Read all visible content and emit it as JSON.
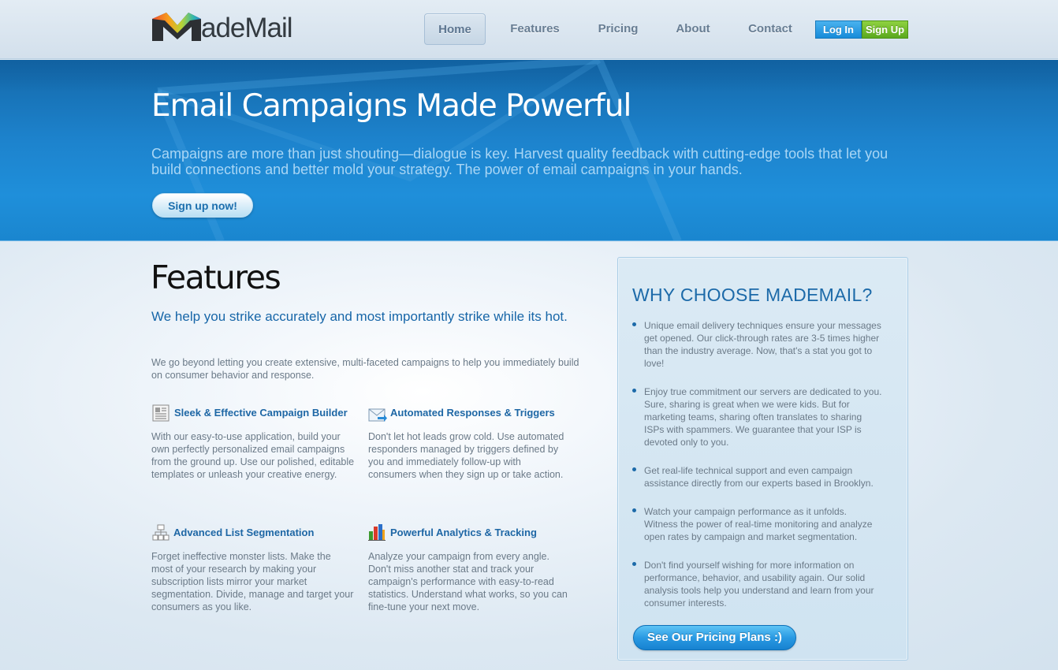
{
  "header": {
    "logo_text": "adeMail",
    "nav": [
      {
        "label": "Home"
      },
      {
        "label": "Features"
      },
      {
        "label": "Pricing"
      },
      {
        "label": "About"
      },
      {
        "label": "Contact"
      }
    ],
    "login_label": "Log In",
    "signup_label": "Sign Up"
  },
  "hero": {
    "title": "Email Campaigns Made Powerful",
    "text": "Campaigns are more than just shouting—dialogue is key. Harvest quality feedback with cutting-edge tools that let you build connections and better mold your strategy. The power of email campaigns in your hands.",
    "cta_label": "Sign up now!"
  },
  "features": {
    "title": "Features",
    "subtitle": "We help you strike accurately and most importantly strike while its hot.",
    "intro": "We go beyond letting you create extensive, multi-faceted campaigns to help you immediately build on consumer behavior and response.",
    "items": [
      {
        "title": "Sleek & Effective Campaign Builder",
        "icon": "newspaper-icon",
        "text": "With our easy-to-use application, build your own perfectly personalized email campaigns from the ground up. Use our polished, editable templates or unleash your creative energy."
      },
      {
        "title": "Automated Responses & Triggers",
        "icon": "mail-arrow-icon",
        "text": "Don't let hot leads grow cold. Use automated responders managed by triggers defined by you and immediately follow-up with consumers when they sign up or take action."
      },
      {
        "title": "Advanced List Segmentation",
        "icon": "hierarchy-icon",
        "text": "Forget ineffective monster lists. Make the most of your research by making your subscription lists mirror your market segmentation. Divide, manage and target your consumers as you like."
      },
      {
        "title": "Powerful Analytics & Tracking",
        "icon": "bar-chart-icon",
        "text": "Analyze your campaign from every angle. Don't miss another stat and track your campaign's performance with easy-to-read statistics. Understand what works, so you can fine-tune your next move."
      }
    ]
  },
  "why": {
    "title": "WHY CHOOSE MADEMAIL?",
    "items": [
      "Unique email delivery techniques ensure your messages get opened. Our click-through rates are 3-5 times higher than the industry average. Now, that's a stat you got to love!",
      "Enjoy true commitment our servers are dedicated to you. Sure, sharing is great when we were kids. But for marketing teams, sharing often translates to sharing ISPs with spammers. We guarantee that your ISP is devoted only to you.",
      "Get real-life technical support and even campaign assistance directly from our experts based in Brooklyn.",
      "Watch your campaign performance as it unfolds. Witness the power of real-time monitoring and analyze open rates by campaign and market segmentation.",
      "Don't find yourself wishing for more information on performance, behavior, and usability again. Our solid analysis tools help you understand and learn from your consumer interests."
    ],
    "cta_label": "See Our Pricing Plans :)"
  },
  "colors": {
    "brand_blue": "#1c6aa9",
    "hero_blue": "#1d83cd",
    "signup_green": "#5aa81d"
  }
}
